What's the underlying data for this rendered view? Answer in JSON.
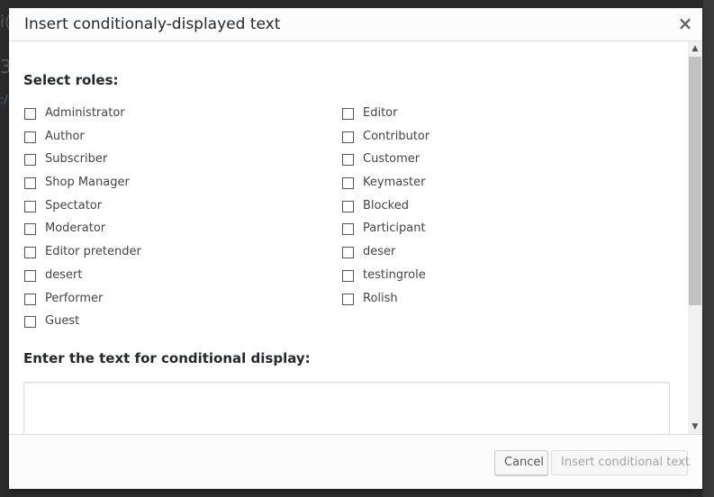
{
  "dialog": {
    "title": "Insert conditionaly-displayed text",
    "close_icon": "close-icon",
    "close_glyph": "×"
  },
  "roles_section": {
    "heading": "Select roles:",
    "left_column": [
      {
        "label": "Administrator",
        "checked": false
      },
      {
        "label": "Author",
        "checked": false
      },
      {
        "label": "Subscriber",
        "checked": false
      },
      {
        "label": "Shop Manager",
        "checked": false
      },
      {
        "label": "Spectator",
        "checked": false
      },
      {
        "label": "Moderator",
        "checked": false
      },
      {
        "label": "Editor pretender",
        "checked": false
      },
      {
        "label": "desert",
        "checked": false
      },
      {
        "label": "Performer",
        "checked": false
      },
      {
        "label": "Guest",
        "checked": false
      }
    ],
    "right_column": [
      {
        "label": "Editor",
        "checked": false
      },
      {
        "label": "Contributor",
        "checked": false
      },
      {
        "label": "Customer",
        "checked": false
      },
      {
        "label": "Keymaster",
        "checked": false
      },
      {
        "label": "Blocked",
        "checked": false
      },
      {
        "label": "Participant",
        "checked": false
      },
      {
        "label": "deser",
        "checked": false
      },
      {
        "label": "testingrole",
        "checked": false
      },
      {
        "label": "Rolish",
        "checked": false
      }
    ]
  },
  "text_section": {
    "heading": "Enter the text for conditional display:",
    "value": ""
  },
  "footer": {
    "cancel_label": "Cancel",
    "insert_label": "Insert conditional text",
    "insert_disabled": true
  },
  "colors": {
    "overlay": "#2b2b2b",
    "dialog_bg": "#ffffff",
    "header_bg": "#fcfcfc",
    "title_text": "#23282d",
    "label_text": "#444444",
    "disabled_text": "#a0a5aa"
  }
}
